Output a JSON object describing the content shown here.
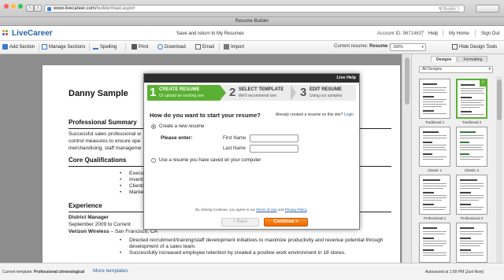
{
  "browser": {
    "url_host": "www.livecareer.com",
    "url_path": "/builder/load.aspx#",
    "reader_label": "Reader",
    "window_title": "Resume Builder"
  },
  "header": {
    "logo_text": "LiveCareer",
    "save_return": "Save and return to My Resumes",
    "account_id": "Account ID: 96714637",
    "help": "Help",
    "my_home": "My Home",
    "sign_out": "Sign Out"
  },
  "toolbar": {
    "add_section": "Add Section",
    "manage_sections": "Manage Sections",
    "spelling": "Spelling",
    "print": "Print",
    "download": "Download",
    "email": "Email",
    "import": "Import",
    "current_resume_label": "Current resume:",
    "current_resume_value": "Resume 1",
    "zoom": "150%",
    "hide_design_tools": "Hide Design Tools"
  },
  "resume": {
    "name": "Danny Sample",
    "summary_heading": "Professional Summary",
    "summary_line1": "Successful sales professional w",
    "summary_line2": "control measures to ensure ope",
    "summary_line3": "merchandising, staff manageme",
    "qualifications_heading": "Core Qualifications",
    "qualifications": [
      "Executive team leaders",
      "Inventory report generat",
      "Client/Vendor relations",
      "Market analysis"
    ],
    "experience_heading": "Experience",
    "job_title": "District Manager",
    "job_dates": "September 2009  to Current",
    "employer": "Verizon Wireless",
    "employer_location": " – San Francisco, CA",
    "job_bullets": [
      "Directed recruitment/training/staff development initiatives to maximize productivity and revenue  potential through",
      "development of a sales team.",
      "Successfully increased employee retention by created a positive work environment in 18 stores."
    ]
  },
  "modal": {
    "live_help": "Live Help",
    "steps": [
      {
        "num": "1",
        "title": "CREATE RESUME",
        "sub": "Or upload an existing one"
      },
      {
        "num": "2",
        "title": "SELECT TEMPLATE",
        "sub": "We'll recommend one"
      },
      {
        "num": "3",
        "title": "EDIT RESUME",
        "sub": "Using our samples"
      }
    ],
    "question": "How do you want to start your resume?",
    "already_text": "Already created a resume on this site?",
    "login_link": "Login",
    "option_new": "Create a new resume",
    "please_enter": "Please enter:",
    "first_name_label": "First Name",
    "last_name_label": "Last Name",
    "option_saved": "Use a resume you have saved on your computer",
    "terms_prefix": "By clicking Continue, you agree to our",
    "terms_link": "Terms of Use",
    "terms_and": "and",
    "privacy_link": "Privacy Policy",
    "back_button": "< Back",
    "continue_button": "Continue >"
  },
  "design_panel": {
    "tab_designs": "Designs",
    "tab_formatting": "Formatting",
    "filter": "All Designs",
    "templates": [
      "Traditional 1",
      "Traditional 2",
      "Classic 1",
      "Classic 2",
      "Professional 1",
      "Professional 2"
    ]
  },
  "bottom": {
    "current_template_label": "Current template:",
    "current_template_value": "Professional chronological",
    "more_templates": "More templates",
    "autosaved": "Autosaved at 1:09 PM [Just Now]"
  },
  "colors": {
    "brand_blue": "#2a63a8",
    "step_green": "#5bb034",
    "continue_orange": "#ea6a00"
  }
}
